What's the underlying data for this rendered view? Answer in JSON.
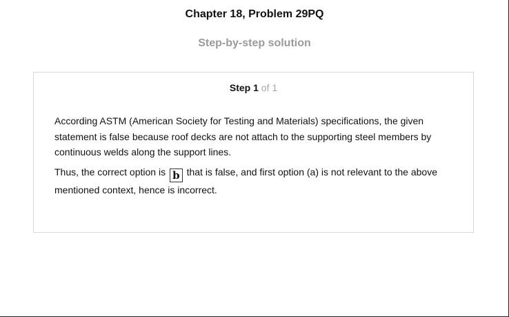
{
  "header": {
    "chapter_title": "Chapter 18, Problem 29PQ",
    "subtitle": "Step-by-step solution"
  },
  "step": {
    "label": "Step",
    "number": "1",
    "of_text": "of 1",
    "paragraph1": "According ASTM (American Society for Testing and Materials) specifications, the given statement is false because roof decks are not attach to the supporting steel members by continuous welds along the support lines.",
    "paragraph2_before": "Thus, the correct option is",
    "answer_option": "b",
    "paragraph2_after": "that is false, and first option (a) is not relevant to the above mentioned context, hence is incorrect."
  }
}
